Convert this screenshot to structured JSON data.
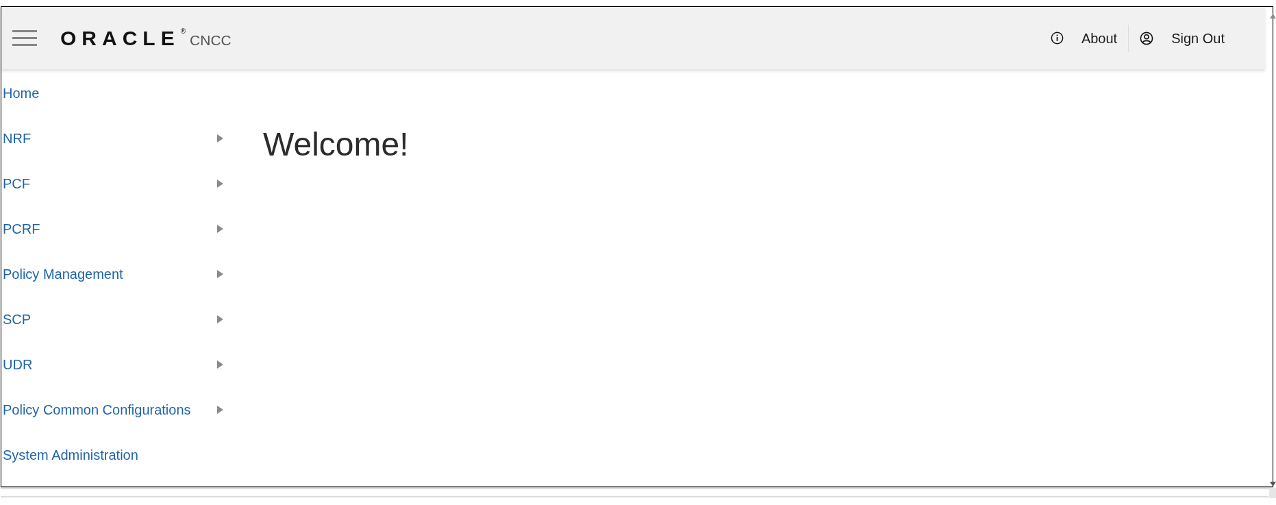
{
  "header": {
    "logo": {
      "wordmark": "ORACLE",
      "registered_mark": "®",
      "product": "CNCC"
    },
    "actions": [
      {
        "label": "About",
        "kind": "info"
      },
      {
        "label": "Sign Out",
        "kind": "user"
      }
    ]
  },
  "sidebar": {
    "items": [
      {
        "label": "Home",
        "has_submenu": false
      },
      {
        "label": "NRF",
        "has_submenu": true
      },
      {
        "label": "PCF",
        "has_submenu": true
      },
      {
        "label": "PCRF",
        "has_submenu": true
      },
      {
        "label": "Policy Management",
        "has_submenu": true
      },
      {
        "label": "SCP",
        "has_submenu": true
      },
      {
        "label": "UDR",
        "has_submenu": true
      },
      {
        "label": "Policy Common Configurations",
        "has_submenu": true
      },
      {
        "label": "System Administration",
        "has_submenu": false
      }
    ]
  },
  "main": {
    "heading": "Welcome!"
  }
}
